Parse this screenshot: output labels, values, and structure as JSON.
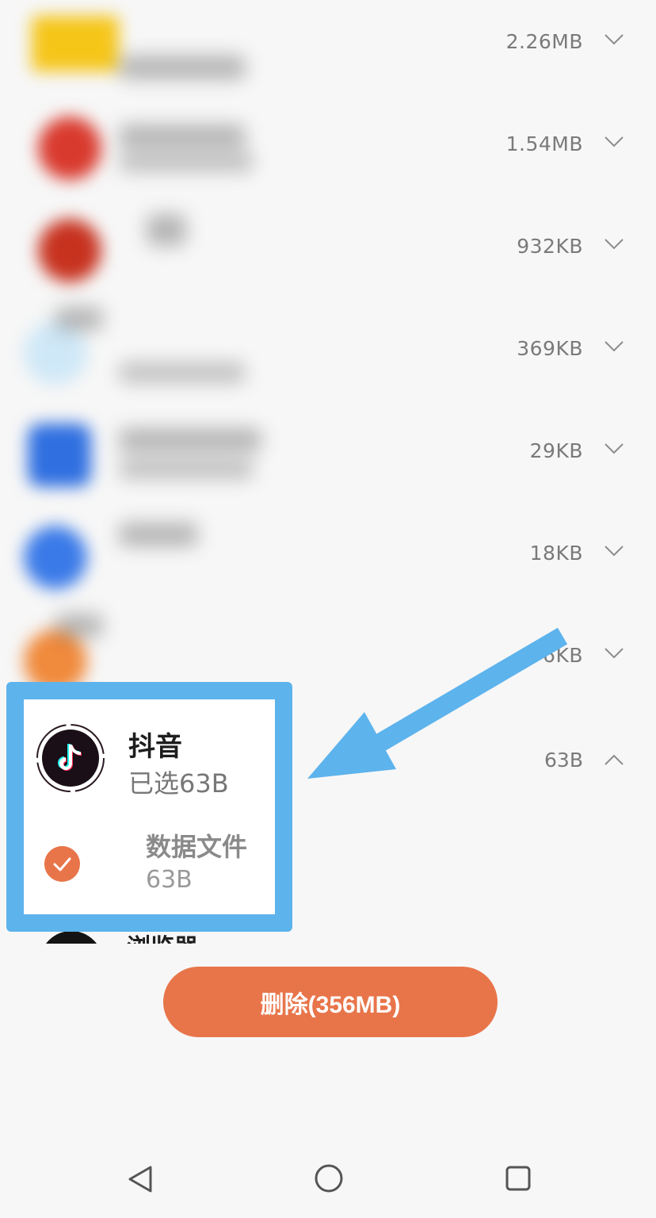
{
  "app_list": [
    {
      "size": "2.26MB",
      "icon_color": "#f5c518"
    },
    {
      "size": "1.54MB",
      "icon_color": "#d93a2e"
    },
    {
      "size": "932KB",
      "icon_color": "#c7321f"
    },
    {
      "size": "369KB",
      "icon_color": "#cfe8f7"
    },
    {
      "size": "29KB",
      "icon_color": "#2f6fe0"
    },
    {
      "size": "18KB",
      "icon_color": "#3a7ae8"
    },
    {
      "size": "6KB",
      "icon_color": "#f08a3c"
    }
  ],
  "selected_app": {
    "name": "抖音",
    "selected_text": "已选63B",
    "size": "63B",
    "file_item": {
      "name": "数据文件",
      "size": "63B",
      "checked": true
    }
  },
  "next_app": {
    "name": "浏览器"
  },
  "delete_button": {
    "label": "删除(356MB)"
  },
  "colors": {
    "accent": "#e8754a",
    "highlight": "#5db3ec"
  },
  "navbar": {
    "back_icon": "back-triangle-icon",
    "home_icon": "home-circle-icon",
    "recent_icon": "recent-square-icon"
  }
}
